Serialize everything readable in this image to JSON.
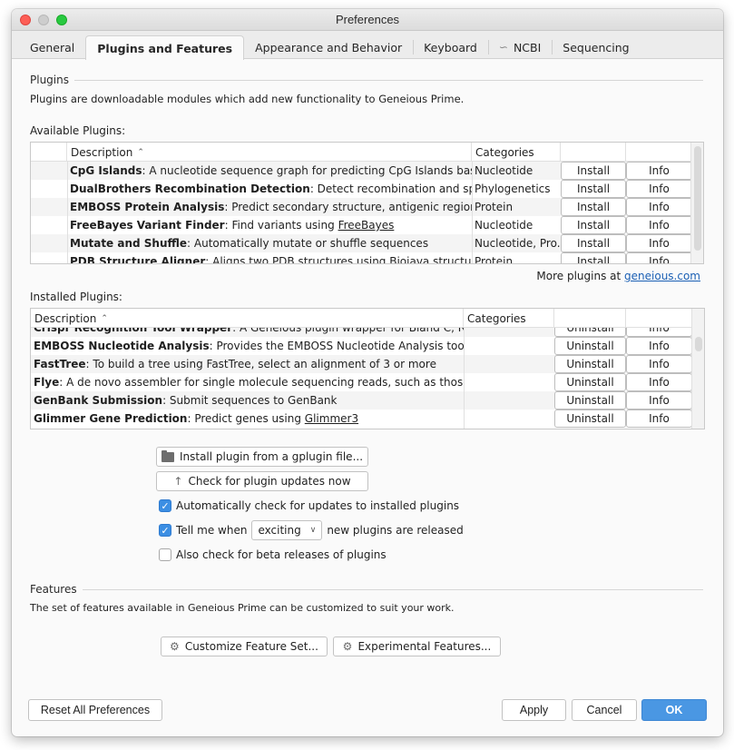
{
  "window": {
    "title": "Preferences"
  },
  "tabs": [
    {
      "label": "General",
      "active": false
    },
    {
      "label": "Plugins and Features",
      "active": true
    },
    {
      "label": "Appearance and Behavior",
      "active": false
    },
    {
      "label": "Keyboard",
      "active": false
    },
    {
      "label": "NCBI",
      "active": false,
      "icon": "dna-helix-icon"
    },
    {
      "label": "Sequencing",
      "active": false
    }
  ],
  "plugins": {
    "heading": "Plugins",
    "description": "Plugins are downloadable modules which add new functionality to Geneious Prime.",
    "available_label": "Available Plugins:",
    "available_table": {
      "columns": [
        "Description",
        "Categories",
        "",
        ""
      ],
      "sort_indicator": "^",
      "rows": [
        {
          "name": "CpG Islands",
          "desc": ": A nucleotide sequence graph for predicting CpG Islands based",
          "category": "Nucleotide",
          "action": "Install",
          "info": "Info"
        },
        {
          "name": "DualBrothers Recombination Detection",
          "desc": ": Detect recombination and spatial",
          "category": "Phylogenetics",
          "action": "Install",
          "info": "Info"
        },
        {
          "name": "EMBOSS Protein Analysis",
          "desc": ": Predict secondary structure, antigenic regions and",
          "category": "Protein",
          "action": "Install",
          "info": "Info"
        },
        {
          "name": "FreeBayes Variant Finder",
          "desc": ": Find variants using ",
          "link": "FreeBayes",
          "category": "Nucleotide",
          "action": "Install",
          "info": "Info"
        },
        {
          "name": "Mutate and Shuffle",
          "desc": ": Automatically mutate or shuffle sequences",
          "category": "Nucleotide, Pro...",
          "action": "Install",
          "info": "Info"
        },
        {
          "name": "PDB Structure Aligner",
          "desc": ": Aligns two PDB structures using Biojava structure",
          "category": "Protein",
          "action": "Install",
          "info": "Info"
        }
      ],
      "scroll_position": 0.0
    },
    "more_plugins_prefix": "More plugins at ",
    "more_plugins_link": "geneious.com",
    "installed_label": "Installed Plugins:",
    "installed_table": {
      "columns": [
        "Description",
        "Categories",
        "",
        ""
      ],
      "sort_indicator": "^",
      "rows": [
        {
          "name": "Crispr Recognition Tool Wrapper",
          "desc": ": A Geneious plugin wrapper for Bland C, Ramsey",
          "category": "",
          "action": "Uninstall",
          "info": "Info"
        },
        {
          "name": "EMBOSS Nucleotide Analysis",
          "desc": ": Provides the EMBOSS Nucleotide Analysis tools",
          "category": "",
          "action": "Uninstall",
          "info": "Info"
        },
        {
          "name": "FastTree",
          "desc": ": To build a tree using FastTree, select an alignment of 3 or more",
          "category": "",
          "action": "Uninstall",
          "info": "Info"
        },
        {
          "name": "Flye",
          "desc": ": A de novo assembler for single molecule sequencing reads, such as those",
          "category": "",
          "action": "Uninstall",
          "info": "Info"
        },
        {
          "name": "GenBank Submission",
          "desc": ": Submit sequences to GenBank",
          "category": "",
          "action": "Uninstall",
          "info": "Info"
        },
        {
          "name": "Glimmer Gene Prediction",
          "desc": ": Predict genes using ",
          "link": "Glimmer3",
          "category": "",
          "action": "Uninstall",
          "info": "Info"
        }
      ],
      "scroll_position": 0.15
    },
    "install_from_file_label": "Install plugin from a gplugin file...",
    "check_updates_label": "Check for plugin updates now",
    "auto_check": {
      "label": "Automatically check for updates to installed plugins",
      "checked": true
    },
    "tell_me": {
      "prefix": "Tell me when",
      "selected": "exciting",
      "suffix": "new plugins are released",
      "checked": true
    },
    "beta": {
      "label": "Also check for beta releases of plugins",
      "checked": false
    }
  },
  "features": {
    "heading": "Features",
    "description": "The set of features available in Geneious Prime can be customized to suit your work.",
    "customize_label": "Customize Feature Set...",
    "experimental_label": "Experimental Features..."
  },
  "footer": {
    "reset_label": "Reset All Preferences",
    "apply_label": "Apply",
    "cancel_label": "Cancel",
    "ok_label": "OK"
  },
  "colors": {
    "accent": "#4a97e3",
    "link": "#1a5fb4",
    "close": "#fd5f57",
    "maximize": "#28c940"
  }
}
